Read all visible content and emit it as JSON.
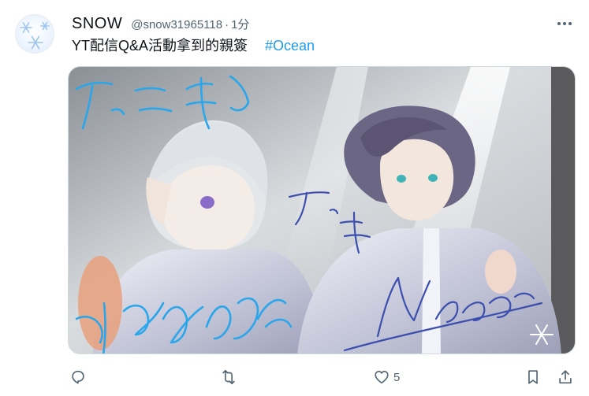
{
  "user": {
    "display_name": "SNOW",
    "handle": "@snow31965118",
    "separator": "·",
    "time": "1分"
  },
  "tweet": {
    "text": "YT配信Q&A活動拿到的親簽",
    "hashtag": "#Ocean"
  },
  "actions": {
    "like_count": "5"
  },
  "colors": {
    "accent": "#1d9bf0",
    "text": "#0f1419",
    "muted": "#536471",
    "border": "#cfd9de"
  },
  "icons": [
    "avatar-snowflake-icon",
    "more-icon",
    "reply-icon",
    "retweet-icon",
    "like-icon",
    "bookmark-icon",
    "share-icon"
  ]
}
